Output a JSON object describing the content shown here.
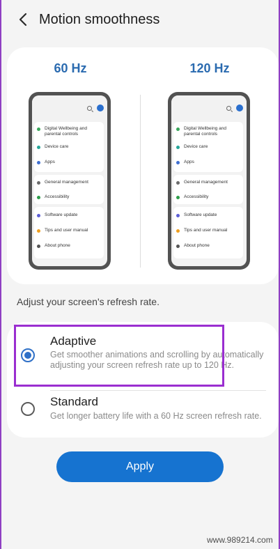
{
  "header": {
    "title": "Motion smoothness",
    "back_icon": "chevron-left-icon"
  },
  "preview": {
    "left_label": "60 Hz",
    "right_label": "120 Hz",
    "settings_rows": [
      {
        "label": "Digital Wellbeing and parental controls",
        "icon_color": "#3aa75b"
      },
      {
        "label": "Device care",
        "icon_color": "#26a69a"
      },
      {
        "label": "Apps",
        "icon_color": "#3f6fd1"
      },
      {
        "label": "General management",
        "icon_color": "#6b6b6b"
      },
      {
        "label": "Accessibility",
        "icon_color": "#2e9e4b"
      },
      {
        "label": "Software update",
        "icon_color": "#5c5ed6"
      },
      {
        "label": "Tips and user manual",
        "icon_color": "#f0a020"
      },
      {
        "label": "About phone",
        "icon_color": "#555555"
      }
    ]
  },
  "helper_text": "Adjust your screen's refresh rate.",
  "options": [
    {
      "title": "Adaptive",
      "description": "Get smoother animations and scrolling by automatically adjusting your screen refresh rate up to 120 Hz.",
      "selected": true
    },
    {
      "title": "Standard",
      "description": "Get longer battery life with a 60 Hz screen refresh rate.",
      "selected": false
    }
  ],
  "apply_label": "Apply",
  "watermark": "www.989214.com",
  "colors": {
    "accent": "#2f70c7",
    "apply_button": "#1673d0",
    "hz_label": "#2b6bb0",
    "highlight": "#9a2ed0"
  }
}
